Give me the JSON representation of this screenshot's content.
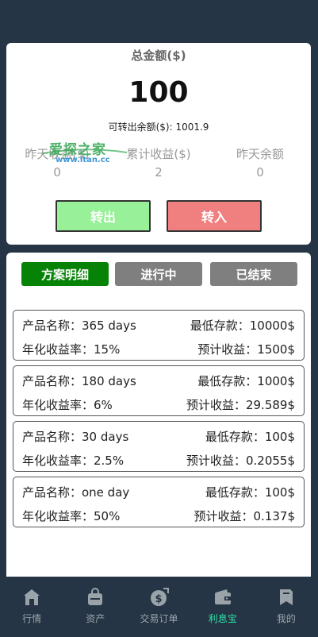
{
  "summary": {
    "total_label": "总金额($)",
    "total_value": "100",
    "transferable_label": "可转出余额($):",
    "transferable_value": "1001.9",
    "stats": [
      {
        "label": "昨天收益($)",
        "value": "0"
      },
      {
        "label": "累计收益($)",
        "value": "2"
      },
      {
        "label": "昨天余额",
        "value": "0"
      }
    ],
    "watermark": {
      "main": "爱探之家",
      "sub": "www.itan.cc"
    },
    "transfer_out_label": "转出",
    "transfer_in_label": "转入",
    "transfer_out_color": "#98f098",
    "transfer_in_color": "#f08080"
  },
  "tabs": {
    "items": [
      {
        "label": "方案明细",
        "active": true,
        "color": "#068206"
      },
      {
        "label": "进行中",
        "active": false,
        "color": "#7f7f7f"
      },
      {
        "label": "已结束",
        "active": false,
        "color": "#7f7f7f"
      }
    ]
  },
  "products": [
    {
      "name": "产品名称：365 days",
      "min_deposit": "最低存款：10000$",
      "rate": "年化收益率：15%",
      "expected": "预计收益：1500$"
    },
    {
      "name": "产品名称：180 days",
      "min_deposit": "最低存款：1000$",
      "rate": "年化收益率：6%",
      "expected": "预计收益：29.589$"
    },
    {
      "name": "产品名称：30 days",
      "min_deposit": "最低存款：100$",
      "rate": "年化收益率：2.5%",
      "expected": "预计收益：0.2055$"
    },
    {
      "name": "产品名称：one day",
      "min_deposit": "最低存款：100$",
      "rate": "年化收益率：50%",
      "expected": "预计收益：0.137$"
    }
  ],
  "tabbar": {
    "items": [
      {
        "label": "行情",
        "icon": "home-icon"
      },
      {
        "label": "资产",
        "icon": "bag-icon"
      },
      {
        "label": "交易订单",
        "icon": "dollar-icon"
      },
      {
        "label": "利息宝",
        "icon": "wallet-icon",
        "active": true
      },
      {
        "label": "我的",
        "icon": "bookmark-icon"
      }
    ],
    "active_color": "#2ee2a6",
    "inactive_color": "#9aa3a8"
  }
}
